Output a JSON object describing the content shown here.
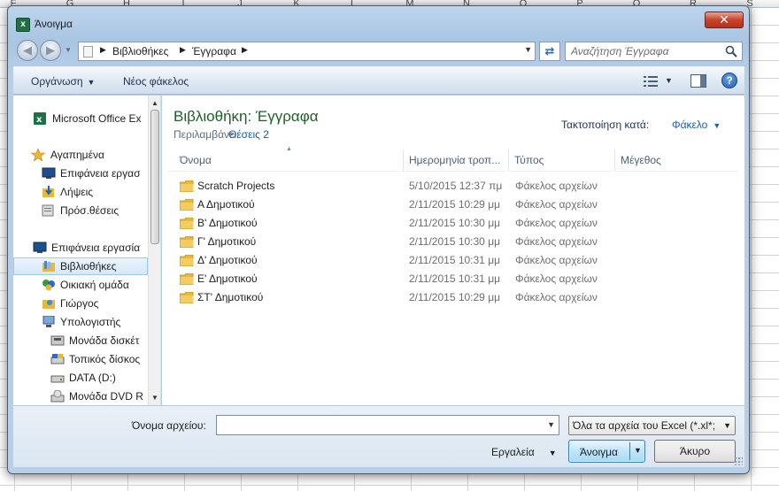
{
  "spreadsheet": {
    "columns": [
      "F",
      "G",
      "H",
      "I",
      "J",
      "K",
      "L",
      "M",
      "N",
      "O",
      "P",
      "Q",
      "R",
      "S"
    ]
  },
  "window": {
    "title": "Άνοιγμα",
    "close_label": "✕"
  },
  "address_bar": {
    "crumbs": [
      "Βιβλιοθήκες",
      "Έγγραφα"
    ]
  },
  "search": {
    "placeholder": "Αναζήτηση Έγγραφα"
  },
  "toolbar": {
    "organize_label": "Οργάνωση",
    "new_folder_label": "Νέος φάκελος",
    "help_label": "?"
  },
  "nav": {
    "items": [
      {
        "label": "Microsoft Office Ex",
        "icon": "excel-icon"
      },
      {
        "label": "Αγαπημένα",
        "icon": "star-icon"
      },
      {
        "label": "Επιφάνεια εργασ",
        "icon": "desktop-icon"
      },
      {
        "label": "Λήψεις",
        "icon": "downloads-icon"
      },
      {
        "label": "Πρόσ.θέσεις",
        "icon": "recent-places-icon"
      },
      {
        "label": "Επιφάνεια εργασία",
        "icon": "desktop-icon"
      },
      {
        "label": "Βιβλιοθήκες",
        "icon": "libraries-icon"
      },
      {
        "label": "Οικιακή ομάδα",
        "icon": "homegroup-icon"
      },
      {
        "label": "Γιώργος",
        "icon": "user-folder-icon"
      },
      {
        "label": "Υπολογιστής",
        "icon": "computer-icon"
      },
      {
        "label": "Μονάδα δισκέτ",
        "icon": "floppy-drive-icon"
      },
      {
        "label": "Τοπικός δίσκος",
        "icon": "local-disk-icon"
      },
      {
        "label": "DATA (D:)",
        "icon": "drive-icon"
      },
      {
        "label": "Μονάδα DVD R",
        "icon": "dvd-drive-icon"
      }
    ]
  },
  "library": {
    "title": "Βιβλιοθήκη: Έγγραφα",
    "includes_label": "Περιλαμβάνει:",
    "includes_link": "Θέσεις 2",
    "arrange_label": "Τακτοποίηση κατά:",
    "arrange_value": "Φάκελο"
  },
  "columns": {
    "name": "Όνομα",
    "date": "Ημερομηνία τροπ...",
    "type": "Τύπος",
    "size": "Μέγεθος"
  },
  "files": [
    {
      "name": "Scratch Projects",
      "date": "5/10/2015 12:37 πμ",
      "type": "Φάκελος αρχείων"
    },
    {
      "name": "Α Δημοτικού",
      "date": "2/11/2015 10:29 μμ",
      "type": "Φάκελος αρχείων"
    },
    {
      "name": "Β' Δημοτικού",
      "date": "2/11/2015 10:30 μμ",
      "type": "Φάκελος αρχείων"
    },
    {
      "name": "Γ' Δημοτικού",
      "date": "2/11/2015 10:30 μμ",
      "type": "Φάκελος αρχείων"
    },
    {
      "name": "Δ' Δημοτικού",
      "date": "2/11/2015 10:31 μμ",
      "type": "Φάκελος αρχείων"
    },
    {
      "name": "Ε' Δημοτικού",
      "date": "2/11/2015 10:31 μμ",
      "type": "Φάκελος αρχείων"
    },
    {
      "name": "ΣΤ' Δημοτικού",
      "date": "2/11/2015 10:29 μμ",
      "type": "Φάκελος αρχείων"
    }
  ],
  "footer": {
    "filename_label": "Όνομα αρχείου:",
    "filename_value": "",
    "filter_label": "Όλα τα αρχεία του  Excel (*.xl*;",
    "tools_label": "Εργαλεία",
    "open_label": "Άνοιγμα",
    "cancel_label": "Άκυρο"
  },
  "colors": {
    "accent_green": "#1e5f28",
    "link_blue": "#1a5dab",
    "folder_yellow": "#e8b83a"
  }
}
